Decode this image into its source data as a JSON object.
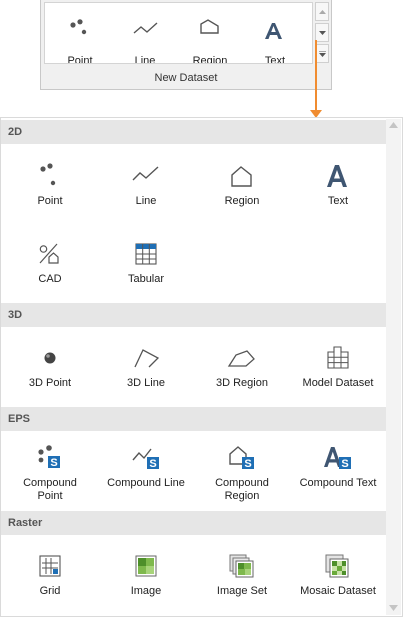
{
  "ribbon": {
    "items": [
      {
        "label": "Point",
        "icon": "point-icon"
      },
      {
        "label": "Line",
        "icon": "line-icon"
      },
      {
        "label": "Region",
        "icon": "region-icon"
      },
      {
        "label": "Text",
        "icon": "text-icon"
      }
    ],
    "caption": "New Dataset"
  },
  "panel": {
    "sections": [
      {
        "title": "2D",
        "items": [
          {
            "label": "Point",
            "icon": "point-icon"
          },
          {
            "label": "Line",
            "icon": "line-icon"
          },
          {
            "label": "Region",
            "icon": "region-icon"
          },
          {
            "label": "Text",
            "icon": "text-icon"
          },
          {
            "label": "CAD",
            "icon": "cad-icon"
          },
          {
            "label": "Tabular",
            "icon": "tabular-icon"
          }
        ]
      },
      {
        "title": "3D",
        "items": [
          {
            "label": "3D Point",
            "icon": "3d-point-icon"
          },
          {
            "label": "3D Line",
            "icon": "3d-line-icon"
          },
          {
            "label": "3D Region",
            "icon": "3d-region-icon"
          },
          {
            "label": "Model Dataset",
            "icon": "model-dataset-icon"
          }
        ]
      },
      {
        "title": "EPS",
        "items": [
          {
            "label": "Compound Point",
            "icon": "compound-point-icon"
          },
          {
            "label": "Compound Line",
            "icon": "compound-line-icon"
          },
          {
            "label": "Compound Region",
            "icon": "compound-region-icon"
          },
          {
            "label": "Compound Text",
            "icon": "compound-text-icon"
          }
        ]
      },
      {
        "title": "Raster",
        "items": [
          {
            "label": "Grid",
            "icon": "grid-icon"
          },
          {
            "label": "Image",
            "icon": "image-icon"
          },
          {
            "label": "Image Set",
            "icon": "image-set-icon"
          },
          {
            "label": "Mosaic Dataset",
            "icon": "mosaic-dataset-icon"
          }
        ]
      }
    ]
  },
  "colors": {
    "accent_arrow": "#f08c30",
    "icon_gray": "#555555",
    "badge_blue": "#1f6fb5",
    "section_bg": "#e6e6e6",
    "raster_green": "#6aaa3a"
  }
}
